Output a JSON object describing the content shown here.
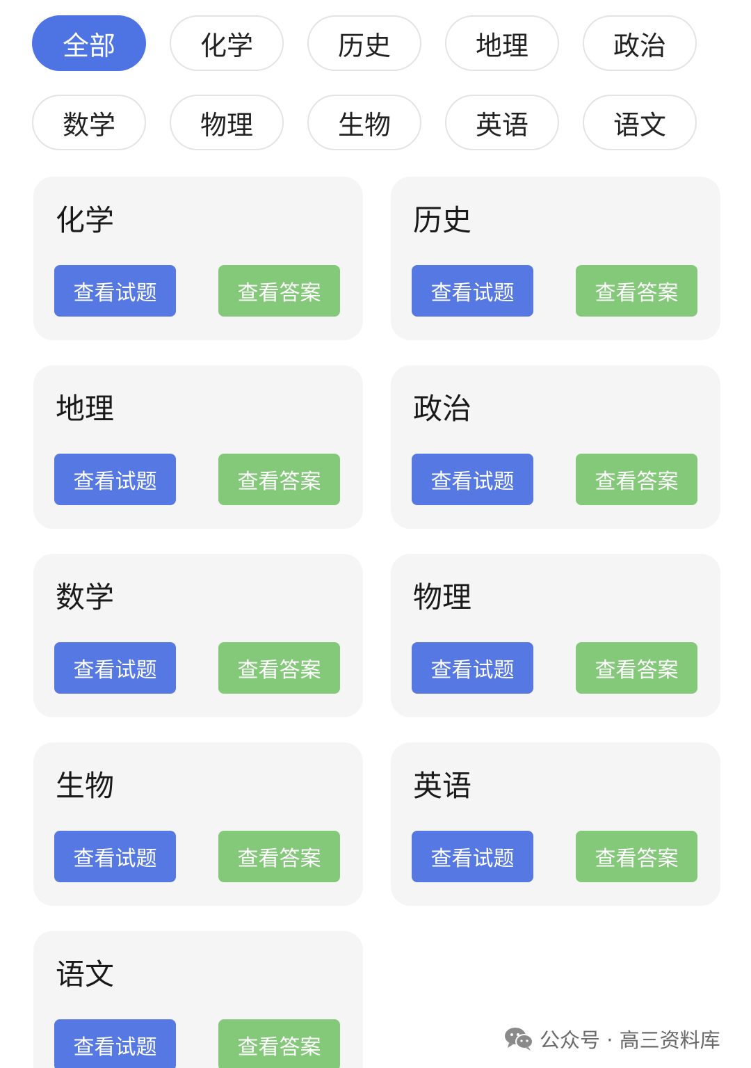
{
  "filter_chips": [
    {
      "label": "全部",
      "active": true
    },
    {
      "label": "化学",
      "active": false
    },
    {
      "label": "历史",
      "active": false
    },
    {
      "label": "地理",
      "active": false
    },
    {
      "label": "政治",
      "active": false
    },
    {
      "label": "数学",
      "active": false
    },
    {
      "label": "物理",
      "active": false
    },
    {
      "label": "生物",
      "active": false
    },
    {
      "label": "英语",
      "active": false
    },
    {
      "label": "语文",
      "active": false
    }
  ],
  "cards": [
    {
      "title": "化学",
      "view_questions": "查看试题",
      "view_answers": "查看答案"
    },
    {
      "title": "历史",
      "view_questions": "查看试题",
      "view_answers": "查看答案"
    },
    {
      "title": "地理",
      "view_questions": "查看试题",
      "view_answers": "查看答案"
    },
    {
      "title": "政治",
      "view_questions": "查看试题",
      "view_answers": "查看答案"
    },
    {
      "title": "数学",
      "view_questions": "查看试题",
      "view_answers": "查看答案"
    },
    {
      "title": "物理",
      "view_questions": "查看试题",
      "view_answers": "查看答案"
    },
    {
      "title": "生物",
      "view_questions": "查看试题",
      "view_answers": "查看答案"
    },
    {
      "title": "英语",
      "view_questions": "查看试题",
      "view_answers": "查看答案"
    },
    {
      "title": "语文",
      "view_questions": "查看试题",
      "view_answers": "查看答案"
    }
  ],
  "watermark": {
    "text": "公众号 · 高三资料库",
    "icon": "wechat-icon"
  },
  "colors": {
    "active_chip": "#4e73e2",
    "view_questions_button": "#5678e3",
    "view_answers_button": "#84c879",
    "card_background": "#f5f5f5"
  }
}
